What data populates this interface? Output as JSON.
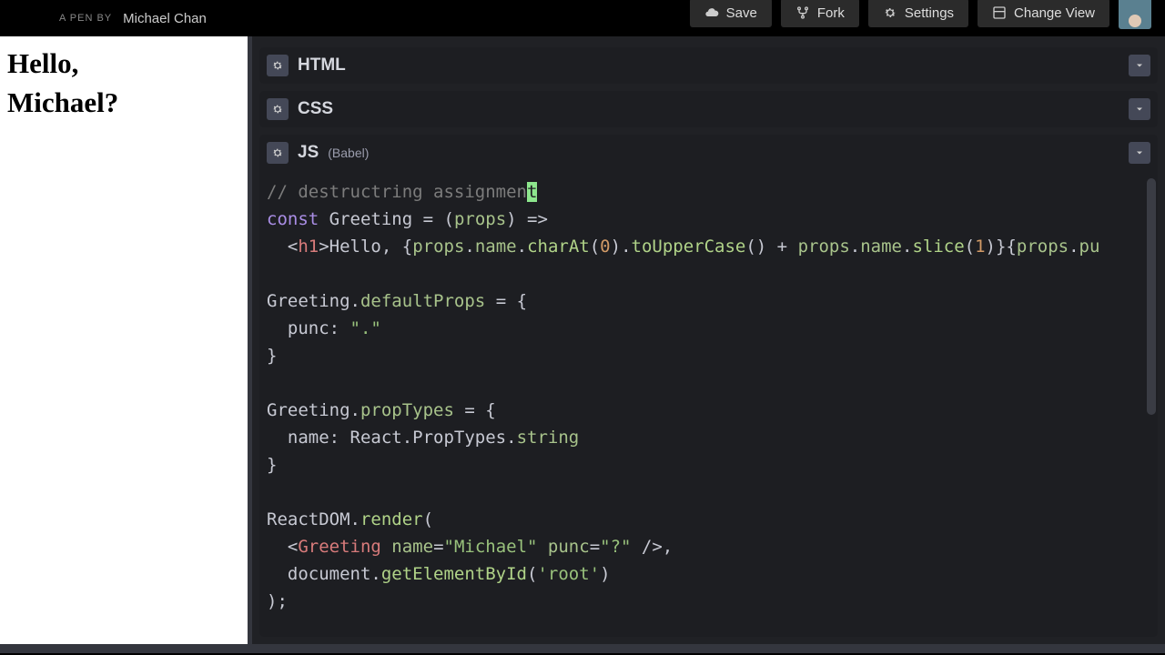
{
  "header": {
    "pen_by_prefix": "A PEN BY",
    "author": "Michael Chan",
    "buttons": {
      "save": "Save",
      "fork": "Fork",
      "settings": "Settings",
      "change_view": "Change View"
    }
  },
  "preview": {
    "line1": "Hello,",
    "line2": "Michael?"
  },
  "panels": {
    "html": {
      "title": "HTML"
    },
    "css": {
      "title": "CSS"
    },
    "js": {
      "title": "JS",
      "sub": "(Babel)"
    }
  },
  "code": {
    "l1_comment_a": "// destructring assignmen",
    "l1_comment_b": "t",
    "l2_kw": "const",
    "l2_name": "Greeting",
    "l2_eq": " = (",
    "l2_props": "props",
    "l2_arrow": ") =>",
    "l3_pre": "  <",
    "l3_tag": "h1",
    "l3_gt": ">",
    "l3_hello": "Hello, ",
    "l3_ob": "{",
    "l3_p1": "props",
    "l3_d1": ".",
    "l3_p2": "name",
    "l3_d2": ".",
    "l3_p3": "charAt",
    "l3_p3a": "(",
    "l3_num0": "0",
    "l3_p3b": ").",
    "l3_p4": "toUpperCase",
    "l3_p4a": "() + ",
    "l3_p5": "props",
    "l3_d3": ".",
    "l3_p6": "name",
    "l3_d4": ".",
    "l3_p7": "slice",
    "l3_p7a": "(",
    "l3_num1": "1",
    "l3_p7b": ")}{",
    "l3_p8": "props",
    "l3_d5": ".",
    "l3_p9": "pu",
    "l5_a": "Greeting",
    "l5_b": ".",
    "l5_c": "defaultProps",
    "l5_d": " = {",
    "l6_a": "  punc: ",
    "l6_b": "\".\"",
    "l7": "}",
    "l9_a": "Greeting",
    "l9_b": ".",
    "l9_c": "propTypes",
    "l9_d": " = {",
    "l10_a": "  name: ",
    "l10_b": "React",
    "l10_c": ".",
    "l10_d": "PropTypes",
    "l10_e": ".",
    "l10_f": "string",
    "l11": "}",
    "l13_a": "ReactDOM",
    "l13_b": ".",
    "l13_c": "render",
    "l13_d": "(",
    "l14_a": "  <",
    "l14_b": "Greeting",
    "l14_c": " ",
    "l14_d": "name",
    "l14_e": "=",
    "l14_f": "\"Michael\"",
    "l14_g": " ",
    "l14_h": "punc",
    "l14_i": "=",
    "l14_j": "\"?\"",
    "l14_k": " />,",
    "l15_a": "  document",
    "l15_b": ".",
    "l15_c": "getElementById",
    "l15_d": "(",
    "l15_e": "'root'",
    "l15_f": ")",
    "l16": ");"
  }
}
